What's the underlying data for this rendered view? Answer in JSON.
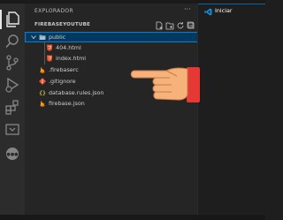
{
  "explorer": {
    "title": "EXPLORADOR",
    "more_glyph": "···",
    "project": "FIREBASEYOUTUBE"
  },
  "tree": [
    {
      "label": "public",
      "kind": "folder",
      "icon": "folder-open-icon"
    },
    {
      "label": "404.html",
      "kind": "file",
      "icon": "html5-icon"
    },
    {
      "label": "index.html",
      "kind": "file",
      "icon": "html5-icon"
    },
    {
      "label": ".firebaserc",
      "kind": "file",
      "icon": "firebase-icon"
    },
    {
      "label": ".gitignore",
      "kind": "file",
      "icon": "git-icon"
    },
    {
      "label": "database.rules.json",
      "kind": "file",
      "icon": "json-icon"
    },
    {
      "label": "firebase.json",
      "kind": "file",
      "icon": "firebase-icon"
    }
  ],
  "tabs": [
    {
      "label": "Iniciar",
      "icon": "vscode-icon",
      "active": true
    }
  ],
  "activity_bar": [
    "files-icon",
    "search-icon",
    "source-control-icon",
    "run-debug-icon",
    "extensions-icon",
    "remote-icon",
    "accounts-icon"
  ],
  "section_actions": [
    "new-file-icon",
    "new-folder-icon",
    "refresh-icon",
    "collapse-all-icon"
  ],
  "pointer": "pointing-hand-icon",
  "colors": {
    "selection": "#04395e",
    "selection_border": "#007fd4",
    "html": "#e44d26",
    "firebase": "#ffa000",
    "git": "#f14e32",
    "json": "#cbcb41",
    "folder": "#90a4ae",
    "accent": "#0e639c"
  }
}
